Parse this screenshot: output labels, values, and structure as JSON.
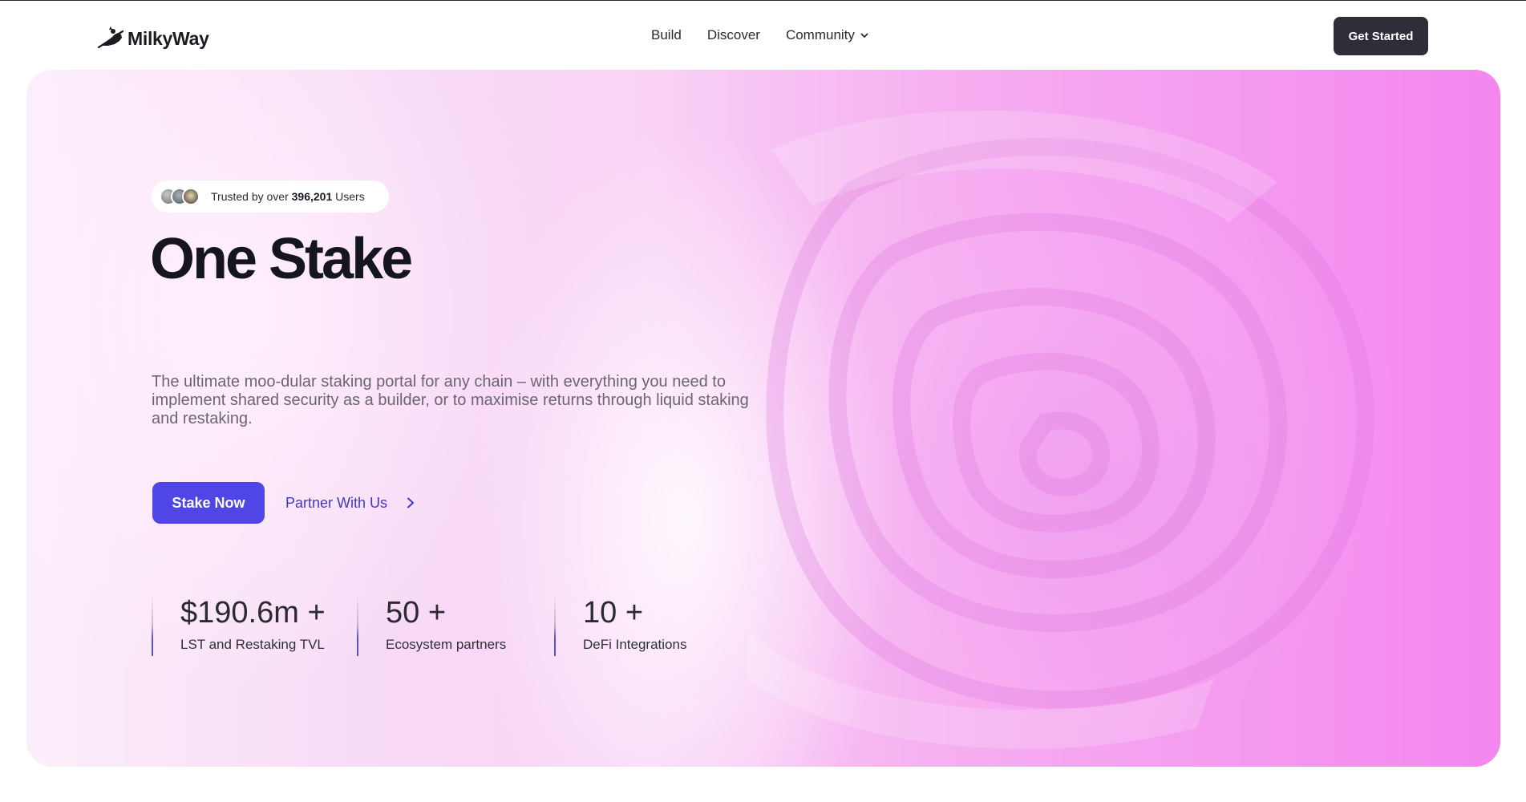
{
  "brand": {
    "name": "MilkyWay",
    "logo_icon": "cow-planet-logo-icon"
  },
  "nav": {
    "items": [
      {
        "label": "Build"
      },
      {
        "label": "Discover"
      },
      {
        "label": "Community",
        "has_dropdown": true
      }
    ],
    "cta_label": "Get Started"
  },
  "hero": {
    "badge": {
      "prefix": "Trusted by over",
      "count": "396,201",
      "suffix": "Users"
    },
    "title": "One Stake",
    "subtitle": "The ultimate moo-dular staking portal for any chain – with everything you need to implement shared security as a builder, or to maximise returns through liquid staking and restaking.",
    "primary_button": "Stake Now",
    "secondary_link": "Partner With Us",
    "stats": [
      {
        "value": "$190.6m +",
        "label": "LST and Restaking TVL"
      },
      {
        "value": "50 +",
        "label": "Ecosystem partners"
      },
      {
        "value": "10 +",
        "label": "DeFi Integrations"
      }
    ]
  },
  "colors": {
    "primary": "#4f46e5",
    "link": "#3f37c9",
    "dark_button": "#2e2e38",
    "hero_pink": "#f586f0"
  }
}
